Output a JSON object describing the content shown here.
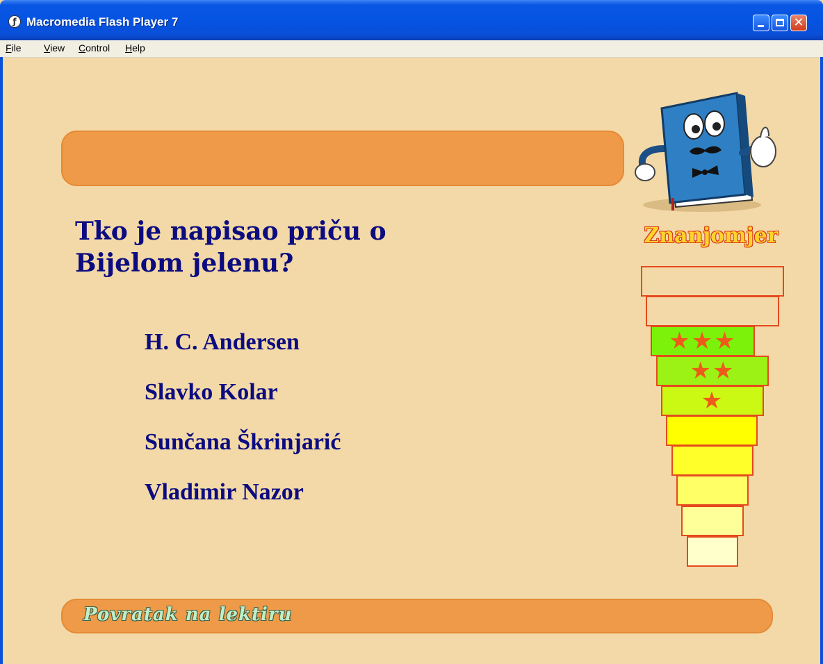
{
  "window": {
    "title": "Macromedia Flash Player 7",
    "close_glyph": "✕",
    "app_icon_glyph": "ƒ"
  },
  "menu": {
    "file": {
      "mnemonic": "F",
      "rest": "ile"
    },
    "view": {
      "mnemonic": "V",
      "rest": "iew"
    },
    "control": {
      "mnemonic": "C",
      "rest": "ontrol"
    },
    "help": {
      "mnemonic": "H",
      "rest": "elp"
    }
  },
  "quiz": {
    "question_line1": "Tko je napisao priču o",
    "question_line2": "Bijelom jelenu?",
    "answers": [
      "H. C. Andersen",
      "Slavko Kolar",
      "Sunčana Škrinjarić",
      "Vladimir Nazor"
    ]
  },
  "meter": {
    "title": "Znanjomjer",
    "levels": [
      {
        "stars": "",
        "color": "#f3d9a7"
      },
      {
        "stars": "",
        "color": "#f3d9a7"
      },
      {
        "stars": "★★★",
        "color": "#7cf20a"
      },
      {
        "stars": "★★",
        "color": "#9cf214"
      },
      {
        "stars": "★",
        "color": "#ccf914"
      },
      {
        "stars": "",
        "color": "#ffff00"
      },
      {
        "stars": "",
        "color": "#ffff2a"
      },
      {
        "stars": "",
        "color": "#ffff66"
      },
      {
        "stars": "",
        "color": "#ffff99"
      },
      {
        "stars": "",
        "color": "#ffffcc"
      }
    ]
  },
  "footer": {
    "back_label": "Povratak na lektiru"
  },
  "colors": {
    "background": "#f3d9a7",
    "bar": "#ef9a48",
    "text": "#0c0c80"
  }
}
